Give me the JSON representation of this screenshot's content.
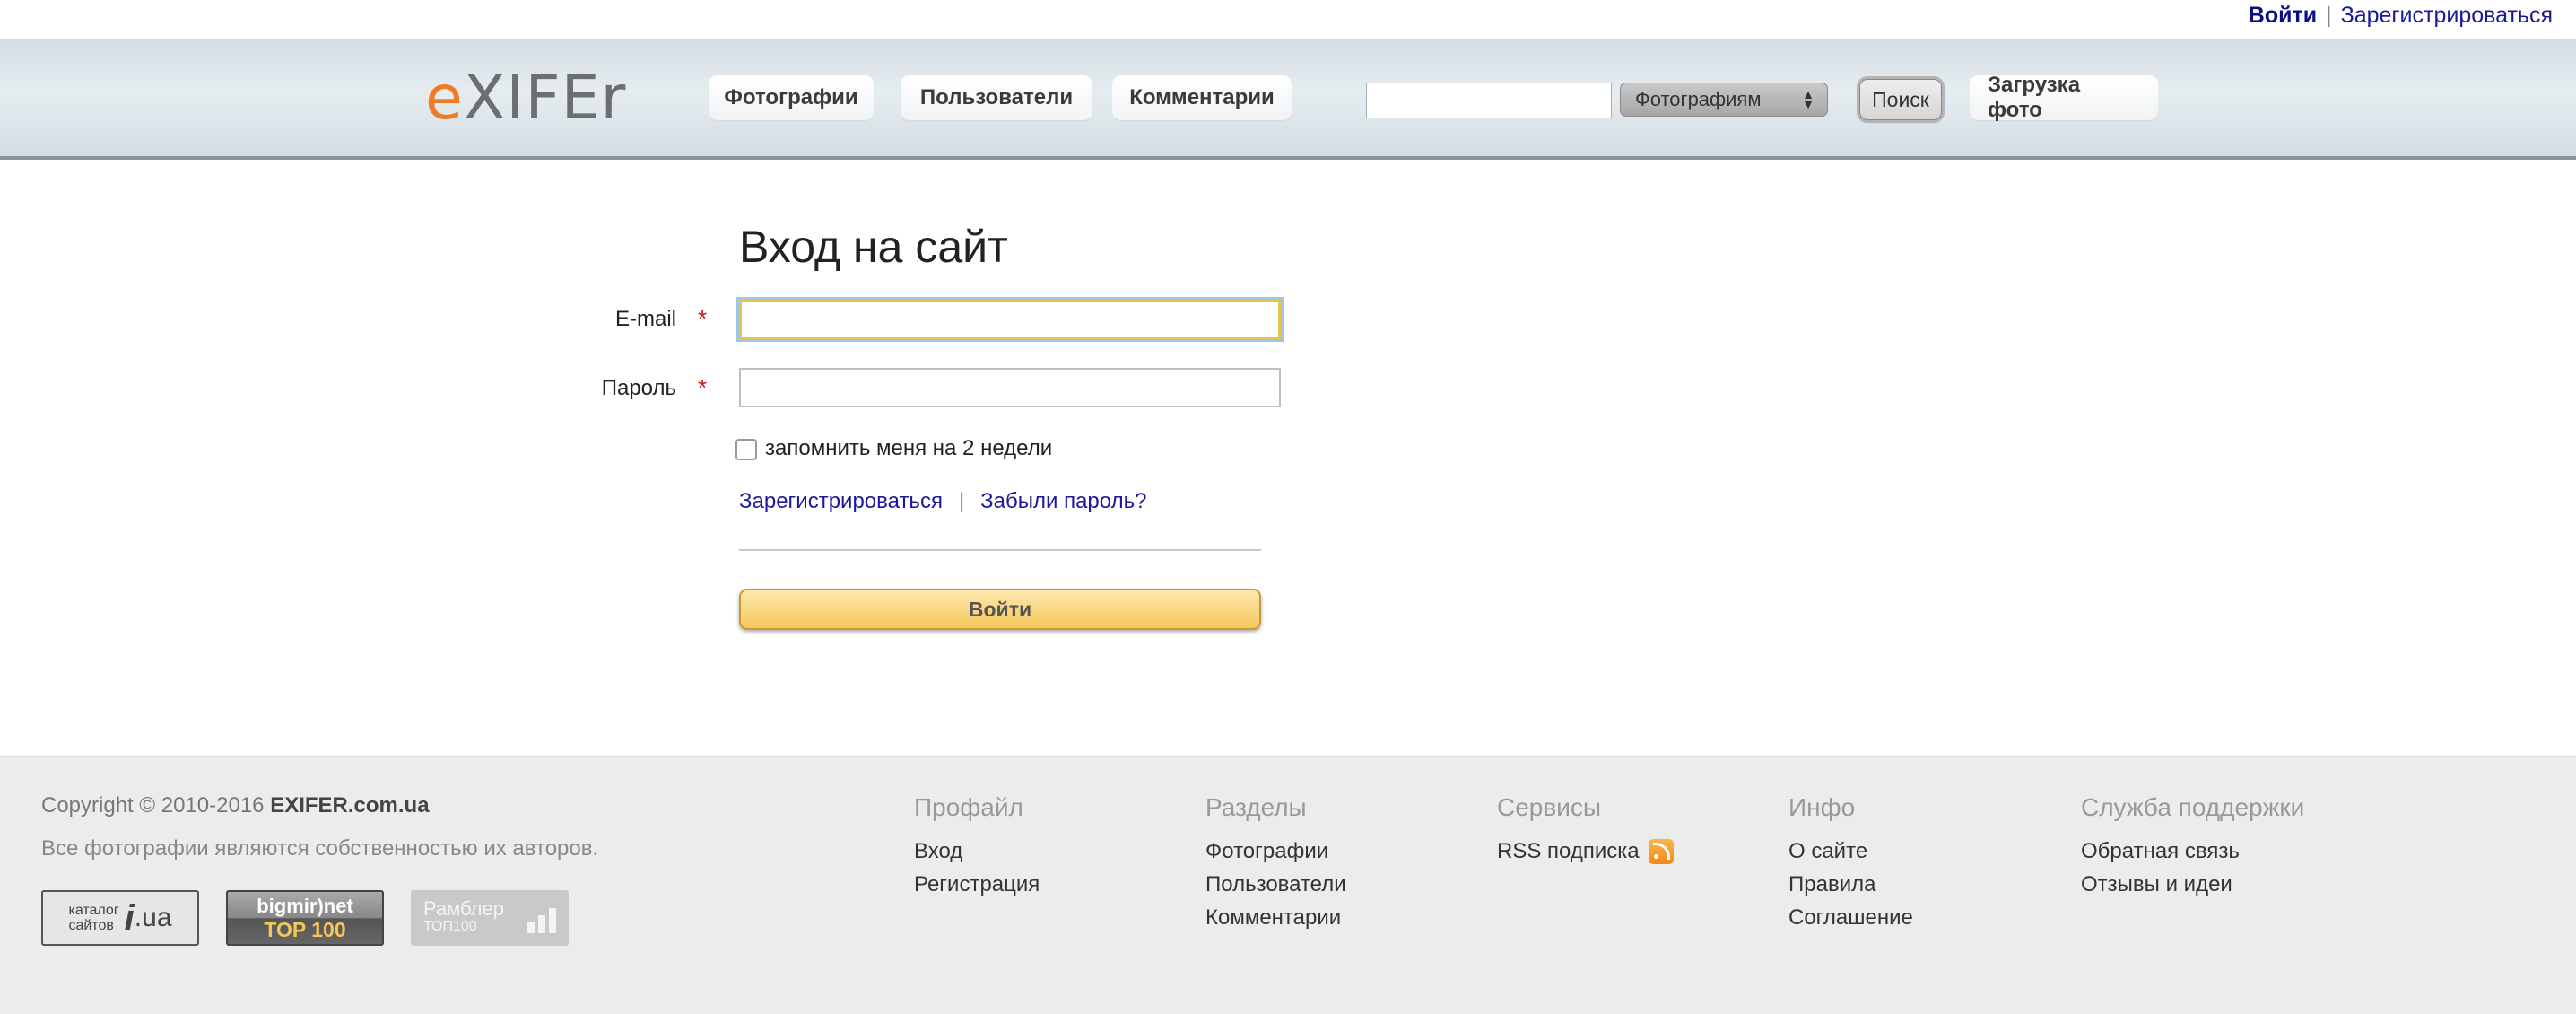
{
  "topbar": {
    "login": "Войти",
    "separator": "|",
    "register": "Зарегистрироваться"
  },
  "header": {
    "logo_e": "e",
    "logo_rest": "XIFEr",
    "nav": [
      "Фотографии",
      "Пользователи",
      "Комментарии"
    ],
    "search": {
      "value": "",
      "select": "Фотографиям",
      "button": "Поиск"
    },
    "upload": "Загрузка фото"
  },
  "login_form": {
    "title": "Вход на сайт",
    "email_label": "E-mail",
    "password_label": "Пароль",
    "required": "*",
    "remember": "запомнить меня на 2 недели",
    "register_link": "Зарегистрироваться",
    "link_sep": "|",
    "forgot_link": "Забыли пароль?",
    "submit": "Войти"
  },
  "footer": {
    "copyright": "Copyright © 2010-2016",
    "site": "EXIFER.com.ua",
    "rights": "Все фотографии являются собственностью их авторов.",
    "badges": {
      "catalog_small": [
        "каталог",
        "сайтов"
      ],
      "catalog_big": "i",
      "catalog_ua": ".ua",
      "bigmir_top": "bigmir)net",
      "bigmir_bottom": "TOP 100",
      "rambler_top": "Рамблер",
      "rambler_bottom": "ТОП100"
    },
    "columns": [
      {
        "head": "Профайл",
        "items": [
          "Вход",
          "Регистрация"
        ]
      },
      {
        "head": "Разделы",
        "items": [
          "Фотографии",
          "Пользователи",
          "Комментарии"
        ]
      },
      {
        "head": "Сервисы",
        "items": [
          "RSS подписка"
        ]
      },
      {
        "head": "Инфо",
        "items": [
          "О сайте",
          "Правила",
          "Соглашение"
        ]
      },
      {
        "head": "Служба поддержки",
        "items": [
          "Обратная связь",
          "Отзывы и идеи"
        ]
      }
    ]
  },
  "colors": {
    "accent": "#f07a26",
    "link": "#1b1b9a",
    "required": "#cc1111",
    "submit": "#f5c65a"
  }
}
